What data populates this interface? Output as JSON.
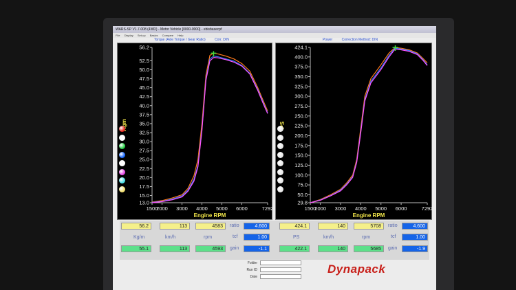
{
  "window": {
    "title": "WARS-SP V1.7-008  (4WD) - Motor Vehicle [0000-0000] - ebisbasecpf",
    "menu": [
      "File",
      "Display",
      "Set-up",
      "Basics",
      "Compare",
      "Help"
    ]
  },
  "headers": {
    "left_title": "Torque (Axle Torque / Gear Ratio)",
    "left_unit": "Corr. DIN",
    "right_title": "Power",
    "right_unit": "Correction Method: DIN"
  },
  "colors": {
    "run_orange": "#ff7a1a",
    "run_blue": "#3a7cff",
    "run_magenta": "#ff50ff",
    "run_cyan": "#3ad6e0",
    "axis_text": "#f0f0f0",
    "label_yellow": "#f2e64a"
  },
  "chart_data": [
    {
      "type": "line",
      "title": "",
      "xlabel": "Engine RPM",
      "ylabel": "Kgm",
      "xlim": [
        1500,
        7292
      ],
      "ylim": [
        13.0,
        56.2
      ],
      "x_ticks": [
        "1500",
        "2000",
        "3000",
        "4000",
        "5000",
        "6000",
        "7292"
      ],
      "y_ticks": [
        "56.2",
        "52.5",
        "50.0",
        "47.5",
        "45.0",
        "42.5",
        "40.0",
        "37.5",
        "35.0",
        "32.5",
        "30.0",
        "27.5",
        "25.0",
        "22.5",
        "20.0",
        "17.5",
        "15.0",
        "13.0"
      ],
      "series": [
        {
          "color": "#ff7a1a",
          "x": [
            1500,
            2000,
            2500,
            3000,
            3300,
            3600,
            3800,
            4000,
            4200,
            4400,
            4583,
            4800,
            5200,
            5600,
            6000,
            6400,
            6800,
            7100,
            7292
          ],
          "values": [
            13.2,
            13.6,
            14.3,
            15.2,
            17.0,
            20.5,
            25.0,
            35.0,
            48.5,
            54.0,
            54.6,
            54.4,
            53.8,
            53.0,
            51.7,
            49.6,
            45.0,
            41.0,
            38.5
          ]
        },
        {
          "color": "#3a7cff",
          "x": [
            1500,
            2000,
            2500,
            3000,
            3300,
            3600,
            3800,
            4000,
            4200,
            4400,
            4593,
            4800,
            5200,
            5600,
            6000,
            6400,
            6800,
            7100,
            7292
          ],
          "values": [
            13.1,
            13.4,
            14.0,
            14.9,
            16.5,
            19.5,
            23.5,
            33.5,
            47.5,
            53.0,
            53.8,
            53.6,
            53.0,
            52.4,
            51.2,
            49.0,
            44.5,
            40.5,
            38.0
          ]
        },
        {
          "color": "#ff50ff",
          "x": [
            1500,
            2000,
            2500,
            3000,
            3300,
            3600,
            3800,
            4000,
            4200,
            4400,
            4600,
            4800,
            5200,
            5600,
            6000,
            6400,
            6800,
            7100,
            7292
          ],
          "values": [
            13.0,
            13.3,
            13.8,
            14.6,
            16.2,
            19.0,
            23.0,
            33.0,
            47.0,
            52.5,
            53.4,
            53.3,
            52.8,
            52.1,
            51.0,
            48.8,
            44.2,
            40.2,
            37.8
          ]
        }
      ]
    },
    {
      "type": "line",
      "title": "",
      "xlabel": "Engine RPM",
      "ylabel": "PS",
      "xlim": [
        1500,
        7292
      ],
      "ylim": [
        29.8,
        424.1
      ],
      "x_ticks": [
        "1500",
        "2000",
        "3000",
        "4000",
        "5000",
        "6000",
        "7292"
      ],
      "y_ticks": [
        "424.1",
        "400.0",
        "375.0",
        "350.0",
        "325.0",
        "300.0",
        "275.0",
        "250.0",
        "225.0",
        "200.0",
        "175.0",
        "150.0",
        "125.0",
        "100.0",
        "75.0",
        "50.0",
        "29.8"
      ],
      "series": [
        {
          "color": "#ff7a1a",
          "x": [
            1500,
            2000,
            2500,
            3000,
            3300,
            3600,
            3800,
            4000,
            4200,
            4500,
            5000,
            5400,
            5708,
            6000,
            6400,
            6800,
            7100,
            7292
          ],
          "values": [
            30,
            38,
            50,
            64,
            80,
            100,
            140,
            220,
            300,
            345,
            380,
            410,
            424.1,
            422,
            418,
            410,
            395,
            385
          ]
        },
        {
          "color": "#3a7cff",
          "x": [
            1500,
            2000,
            2500,
            3000,
            3300,
            3600,
            3800,
            4000,
            4200,
            4500,
            5000,
            5400,
            5685,
            6000,
            6400,
            6800,
            7100,
            7292
          ],
          "values": [
            30,
            37,
            48,
            62,
            77,
            96,
            135,
            212,
            292,
            338,
            372,
            404,
            422.1,
            420,
            416,
            408,
            392,
            380
          ]
        },
        {
          "color": "#ff50ff",
          "x": [
            1500,
            2000,
            2500,
            3000,
            3300,
            3600,
            3800,
            4000,
            4200,
            4500,
            5000,
            5400,
            5700,
            6000,
            6400,
            6800,
            7100,
            7292
          ],
          "values": [
            29.8,
            36,
            47,
            60,
            75,
            94,
            132,
            208,
            288,
            334,
            368,
            400,
            420,
            418,
            414,
            406,
            390,
            378
          ]
        }
      ]
    }
  ],
  "swatches": {
    "left": [
      {
        "label": "30.0",
        "color": "#e8281e"
      },
      {
        "label": "27.5",
        "color": "#ffffff"
      },
      {
        "label": "25.0",
        "color": "#2ad04a"
      },
      {
        "label": "22.5",
        "color": "#1a6aff"
      },
      {
        "label": "20.0",
        "color": "#ffffff"
      },
      {
        "label": "17.5",
        "color": "#e64ae6"
      },
      {
        "label": "15.0",
        "color": "#4ae0e6"
      },
      {
        "label": "13.0",
        "color": "#f2e070"
      }
    ],
    "right_count": 8
  },
  "readouts": {
    "left": {
      "row1": [
        "56.2",
        "113",
        "4583"
      ],
      "units": [
        "Kg/m",
        "km/h",
        "rpm"
      ],
      "row2": [
        "55.1",
        "113",
        "4593"
      ],
      "ratio_label": "ratio",
      "ratio": "4.600",
      "tcf_label": "tcf",
      "tcf": "1.00",
      "gain_label": "gain",
      "gain": "-1.1"
    },
    "right": {
      "row1": [
        "424.1",
        "140",
        "5708"
      ],
      "units": [
        "PS",
        "km/h",
        "rpm"
      ],
      "row2": [
        "422.1",
        "140",
        "5685"
      ],
      "ratio_label": "ratio",
      "ratio": "4.600",
      "tcf_label": "tcf",
      "tcf": "1.00",
      "gain_label": "gain",
      "gain": "-1.9"
    }
  },
  "form": {
    "folder_label": "Folder",
    "run_id_label": "Run ID",
    "date_label": "Date"
  },
  "brand": {
    "logo": "Dynapack"
  }
}
